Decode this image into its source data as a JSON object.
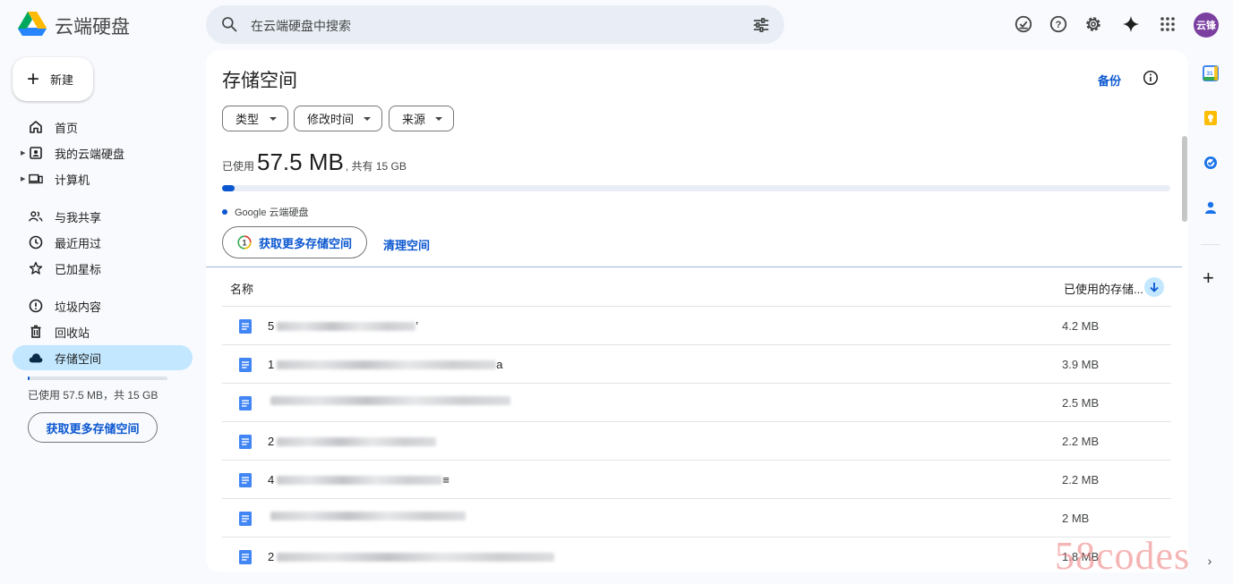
{
  "app": {
    "brand": "云端硬盘",
    "search_placeholder": "在云端硬盘中搜索",
    "avatar_text": "云锋"
  },
  "sidebar": {
    "new_label": "新建",
    "items": [
      {
        "label": "首页",
        "icon": "home-icon"
      },
      {
        "label": "我的云端硬盘",
        "icon": "my-drive-icon"
      },
      {
        "label": "计算机",
        "icon": "computers-icon"
      },
      {
        "label": "与我共享",
        "icon": "shared-icon"
      },
      {
        "label": "最近用过",
        "icon": "recent-icon"
      },
      {
        "label": "已加星标",
        "icon": "star-icon"
      },
      {
        "label": "垃圾内容",
        "icon": "spam-icon"
      },
      {
        "label": "回收站",
        "icon": "trash-icon"
      },
      {
        "label": "存储空间",
        "icon": "cloud-icon"
      }
    ],
    "storage_text": "已使用 57.5 MB，共 15 GB",
    "storage_fraction": 0.004,
    "get_more_label": "获取更多存储空间"
  },
  "main": {
    "title": "存储空间",
    "backup_label": "备份",
    "filters": [
      "类型",
      "修改时间",
      "来源"
    ],
    "usage_prefix": "已使用",
    "usage_value": "57.5 MB",
    "usage_suffix": ", 共有 15 GB",
    "usage_fraction": 0.004,
    "legend_label": "Google 云端硬盘",
    "get_more_label": "获取更多存储空间",
    "clean_label": "清理空间",
    "col_name": "名称",
    "col_size": "已使用的存储...",
    "rows": [
      {
        "prefix": "5",
        "suffix": "’",
        "size": "4.2 MB",
        "blur": 155
      },
      {
        "prefix": "1",
        "suffix": "a",
        "size": "3.9 MB",
        "blur": 245
      },
      {
        "prefix": "",
        "suffix": "",
        "size": "2.5 MB",
        "blur": 268
      },
      {
        "prefix": "2",
        "suffix": "",
        "size": "2.2 MB",
        "blur": 178
      },
      {
        "prefix": "4",
        "suffix": "≡",
        "size": "2.2 MB",
        "blur": 185
      },
      {
        "prefix": "",
        "suffix": "",
        "size": "2 MB",
        "blur": 218
      },
      {
        "prefix": "2",
        "suffix": "",
        "size": "1.8 MB",
        "blur": 310
      }
    ]
  },
  "watermark": "58codes"
}
